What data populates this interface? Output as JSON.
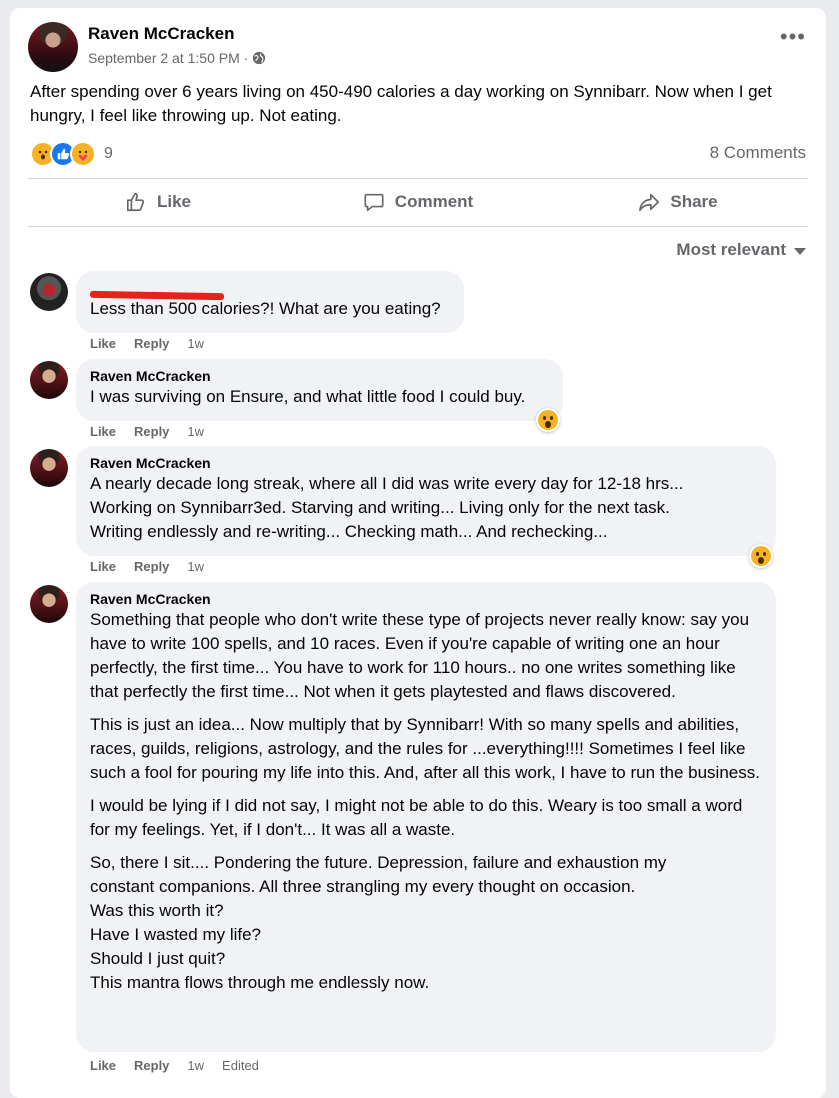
{
  "post": {
    "author": "Raven McCracken",
    "timestamp": "September 2 at 1:50 PM ·",
    "privacy_icon": "globe-icon",
    "text": "After spending over 6 years living on 450-490 calories a day working on Synnibarr.  Now when I get hungry, I feel like throwing up.  Not eating.",
    "reaction_count": "9",
    "comments_count": "8 Comments"
  },
  "actions": {
    "like": "Like",
    "comment": "Comment",
    "share": "Share"
  },
  "sort_label": "Most relevant",
  "comments": [
    {
      "author": "",
      "text": "Less than 500 calories?! What are you eating?",
      "like": "Like",
      "reply": "Reply",
      "time": "1w"
    },
    {
      "author": "Raven McCracken",
      "text": "I was surviving on Ensure, and what little food I could buy.",
      "like": "Like",
      "reply": "Reply",
      "time": "1w"
    },
    {
      "author": "Raven McCracken",
      "lines": [
        "A nearly decade long streak, where all I did was write every day for 12-18 hrs...",
        "Working on Synnibarr3ed. Starving and writing... Living only for the next task.",
        "Writing endlessly and re-writing... Checking math... And rechecking..."
      ],
      "like": "Like",
      "reply": "Reply",
      "time": "1w"
    },
    {
      "author": "Raven McCracken",
      "paragraphs": [
        "Something that people who don't write these type of projects never really know: say you have to write 100 spells, and 10 races. Even if you're capable of writing one an hour perfectly, the first time... You have to work for 110 hours.. no one writes something like that perfectly the first time... Not when it gets playtested and flaws discovered.",
        "This is just an idea... Now multiply that by Synnibarr! With so many spells and abilities, races, guilds, religions, astrology, and the rules for ...everything!!!! Sometimes I feel like such a fool for pouring my life into this. And, after all this work, I have to run the business.",
        "I would be lying if I did not say, I might not be able to do this. Weary is too small a word for my feelings. Yet, if I don't... It was all a waste."
      ],
      "last_lines": [
        "So, there I sit.... Pondering the future. Depression, failure and exhaustion my",
        "constant companions. All three strangling my every thought on occasion.",
        "Was this worth it?",
        "Have I wasted my life?",
        "Should I just quit?",
        "This mantra flows through me endlessly now."
      ],
      "like": "Like",
      "reply": "Reply",
      "time": "1w",
      "edited": "Edited"
    }
  ]
}
